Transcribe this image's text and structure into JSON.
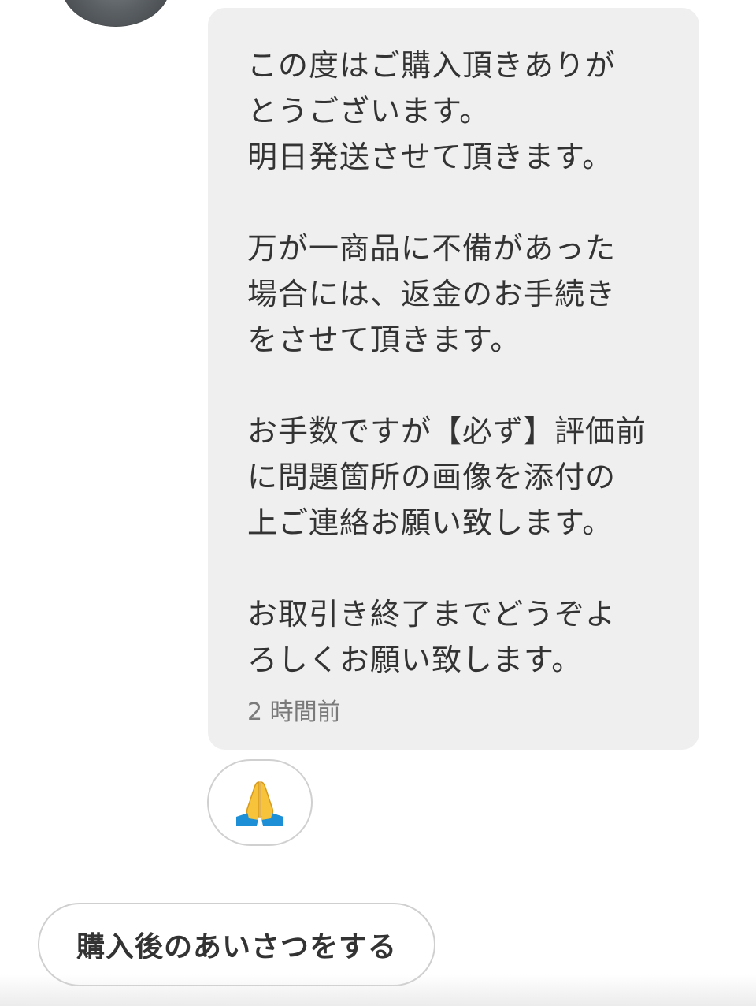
{
  "message": {
    "paragraphs": [
      [
        "この度はご購入頂きありが",
        "とうございます。",
        "明日発送させて頂きます。"
      ],
      [
        "万が一商品に不備があった",
        "場合には、返金のお手続き",
        "をさせて頂きます。"
      ],
      [
        "お手数ですが【必ず】評価前",
        "に問題箇所の画像を添付の",
        "上ご連絡お願い致します。"
      ],
      [
        "お取引き終了までどうぞよ",
        "ろしくお願い致します。"
      ]
    ],
    "timestamp": "2 時間前"
  },
  "reaction": {
    "icon": "folded-hands-icon"
  },
  "actions": {
    "greeting_button_label": "購入後のあいさつをする"
  },
  "colors": {
    "bubble_background": "#efefef",
    "text": "#333333",
    "timestamp_text": "#7a7a7a",
    "button_border": "#cfcfcf"
  }
}
